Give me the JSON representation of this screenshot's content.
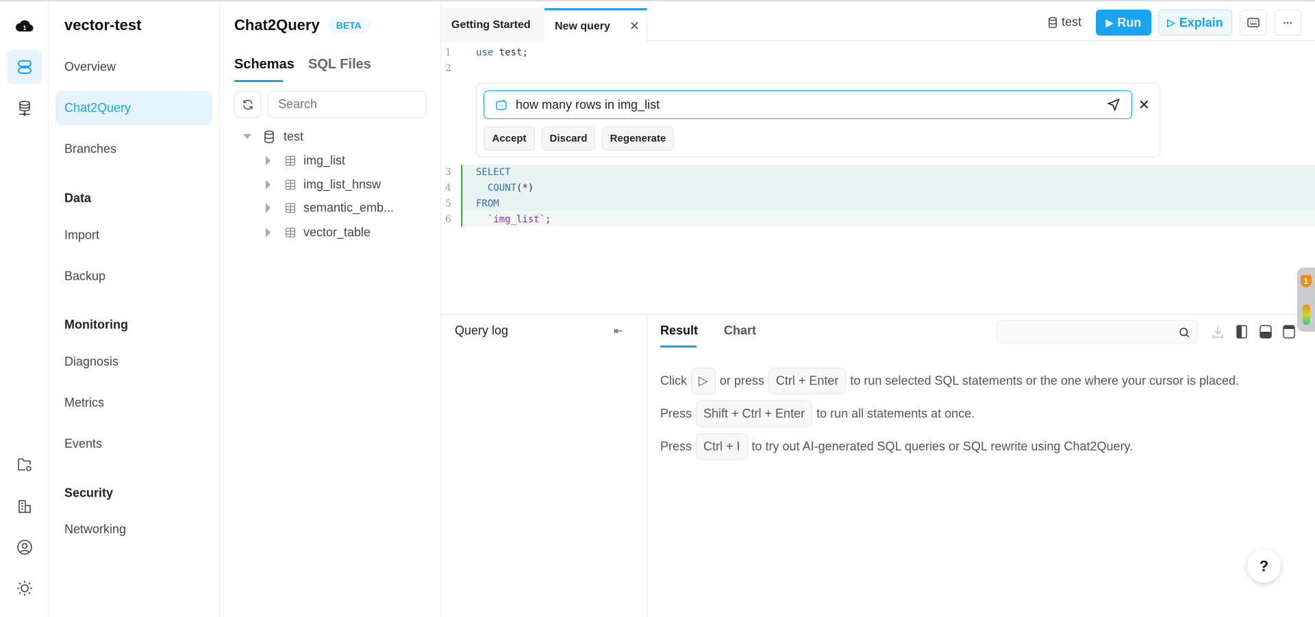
{
  "rail": {
    "icons": [
      "cloud-logo-icon",
      "clusters-icon",
      "database-network-icon",
      "folder-settings-icon",
      "organization-icon",
      "user-icon",
      "theme-sun-icon"
    ]
  },
  "nav": {
    "title": "vector-test",
    "items": [
      {
        "label": "Overview"
      },
      {
        "label": "Chat2Query",
        "active": true
      },
      {
        "label": "Branches"
      }
    ],
    "sections": [
      {
        "heading": "Data",
        "items": [
          "Import",
          "Backup"
        ]
      },
      {
        "heading": "Monitoring",
        "items": [
          "Diagnosis",
          "Metrics",
          "Events"
        ]
      },
      {
        "heading": "Security",
        "items": [
          "Networking"
        ]
      }
    ]
  },
  "schema": {
    "title": "Chat2Query",
    "badge": "BETA",
    "tabs": [
      "Schemas",
      "SQL Files"
    ],
    "search_placeholder": "Search",
    "database": "test",
    "tables": [
      "img_list",
      "img_list_hnsw",
      "semantic_emb...",
      "vector_table"
    ]
  },
  "tabs": [
    {
      "label": "Getting Started"
    },
    {
      "label": "New query",
      "active": true
    }
  ],
  "toolbar": {
    "db": "test",
    "run": "Run",
    "explain": "Explain"
  },
  "editor": {
    "lines": [
      {
        "n": "1",
        "kw": "use",
        "rest": " test;"
      },
      {
        "n": "2"
      },
      {
        "n": "3",
        "kw": "SELECT"
      },
      {
        "n": "4",
        "kw": "  COUNT",
        "rest": "(*)"
      },
      {
        "n": "5",
        "kw": "FROM"
      },
      {
        "n": "6",
        "ident": "  `img_list`",
        "rest": ";"
      }
    ]
  },
  "chat": {
    "prompt": "how many rows in img_list",
    "buttons": [
      "Accept",
      "Discard",
      "Regenerate"
    ]
  },
  "bottom": {
    "query_log": "Query log",
    "tabs": [
      "Result",
      "Chart"
    ],
    "help": {
      "l1a": "Click",
      "l1b": "or press",
      "l1k": "Ctrl + Enter",
      "l1c": "to run selected SQL statements or the one where your cursor is placed.",
      "l2a": "Press",
      "l2k": "Shift + Ctrl + Enter",
      "l2c": "to run all statements at once.",
      "l3a": "Press",
      "l3k": "Ctrl + I",
      "l3c": "to try out AI-generated SQL queries or SQL rewrite using Chat2Query."
    }
  },
  "widget": {
    "badge": "1"
  },
  "help_button": "?",
  "colors": {
    "accent": "#1aa3f0",
    "active_bg": "#e6f5fd",
    "diff_green": "#2db52d"
  }
}
